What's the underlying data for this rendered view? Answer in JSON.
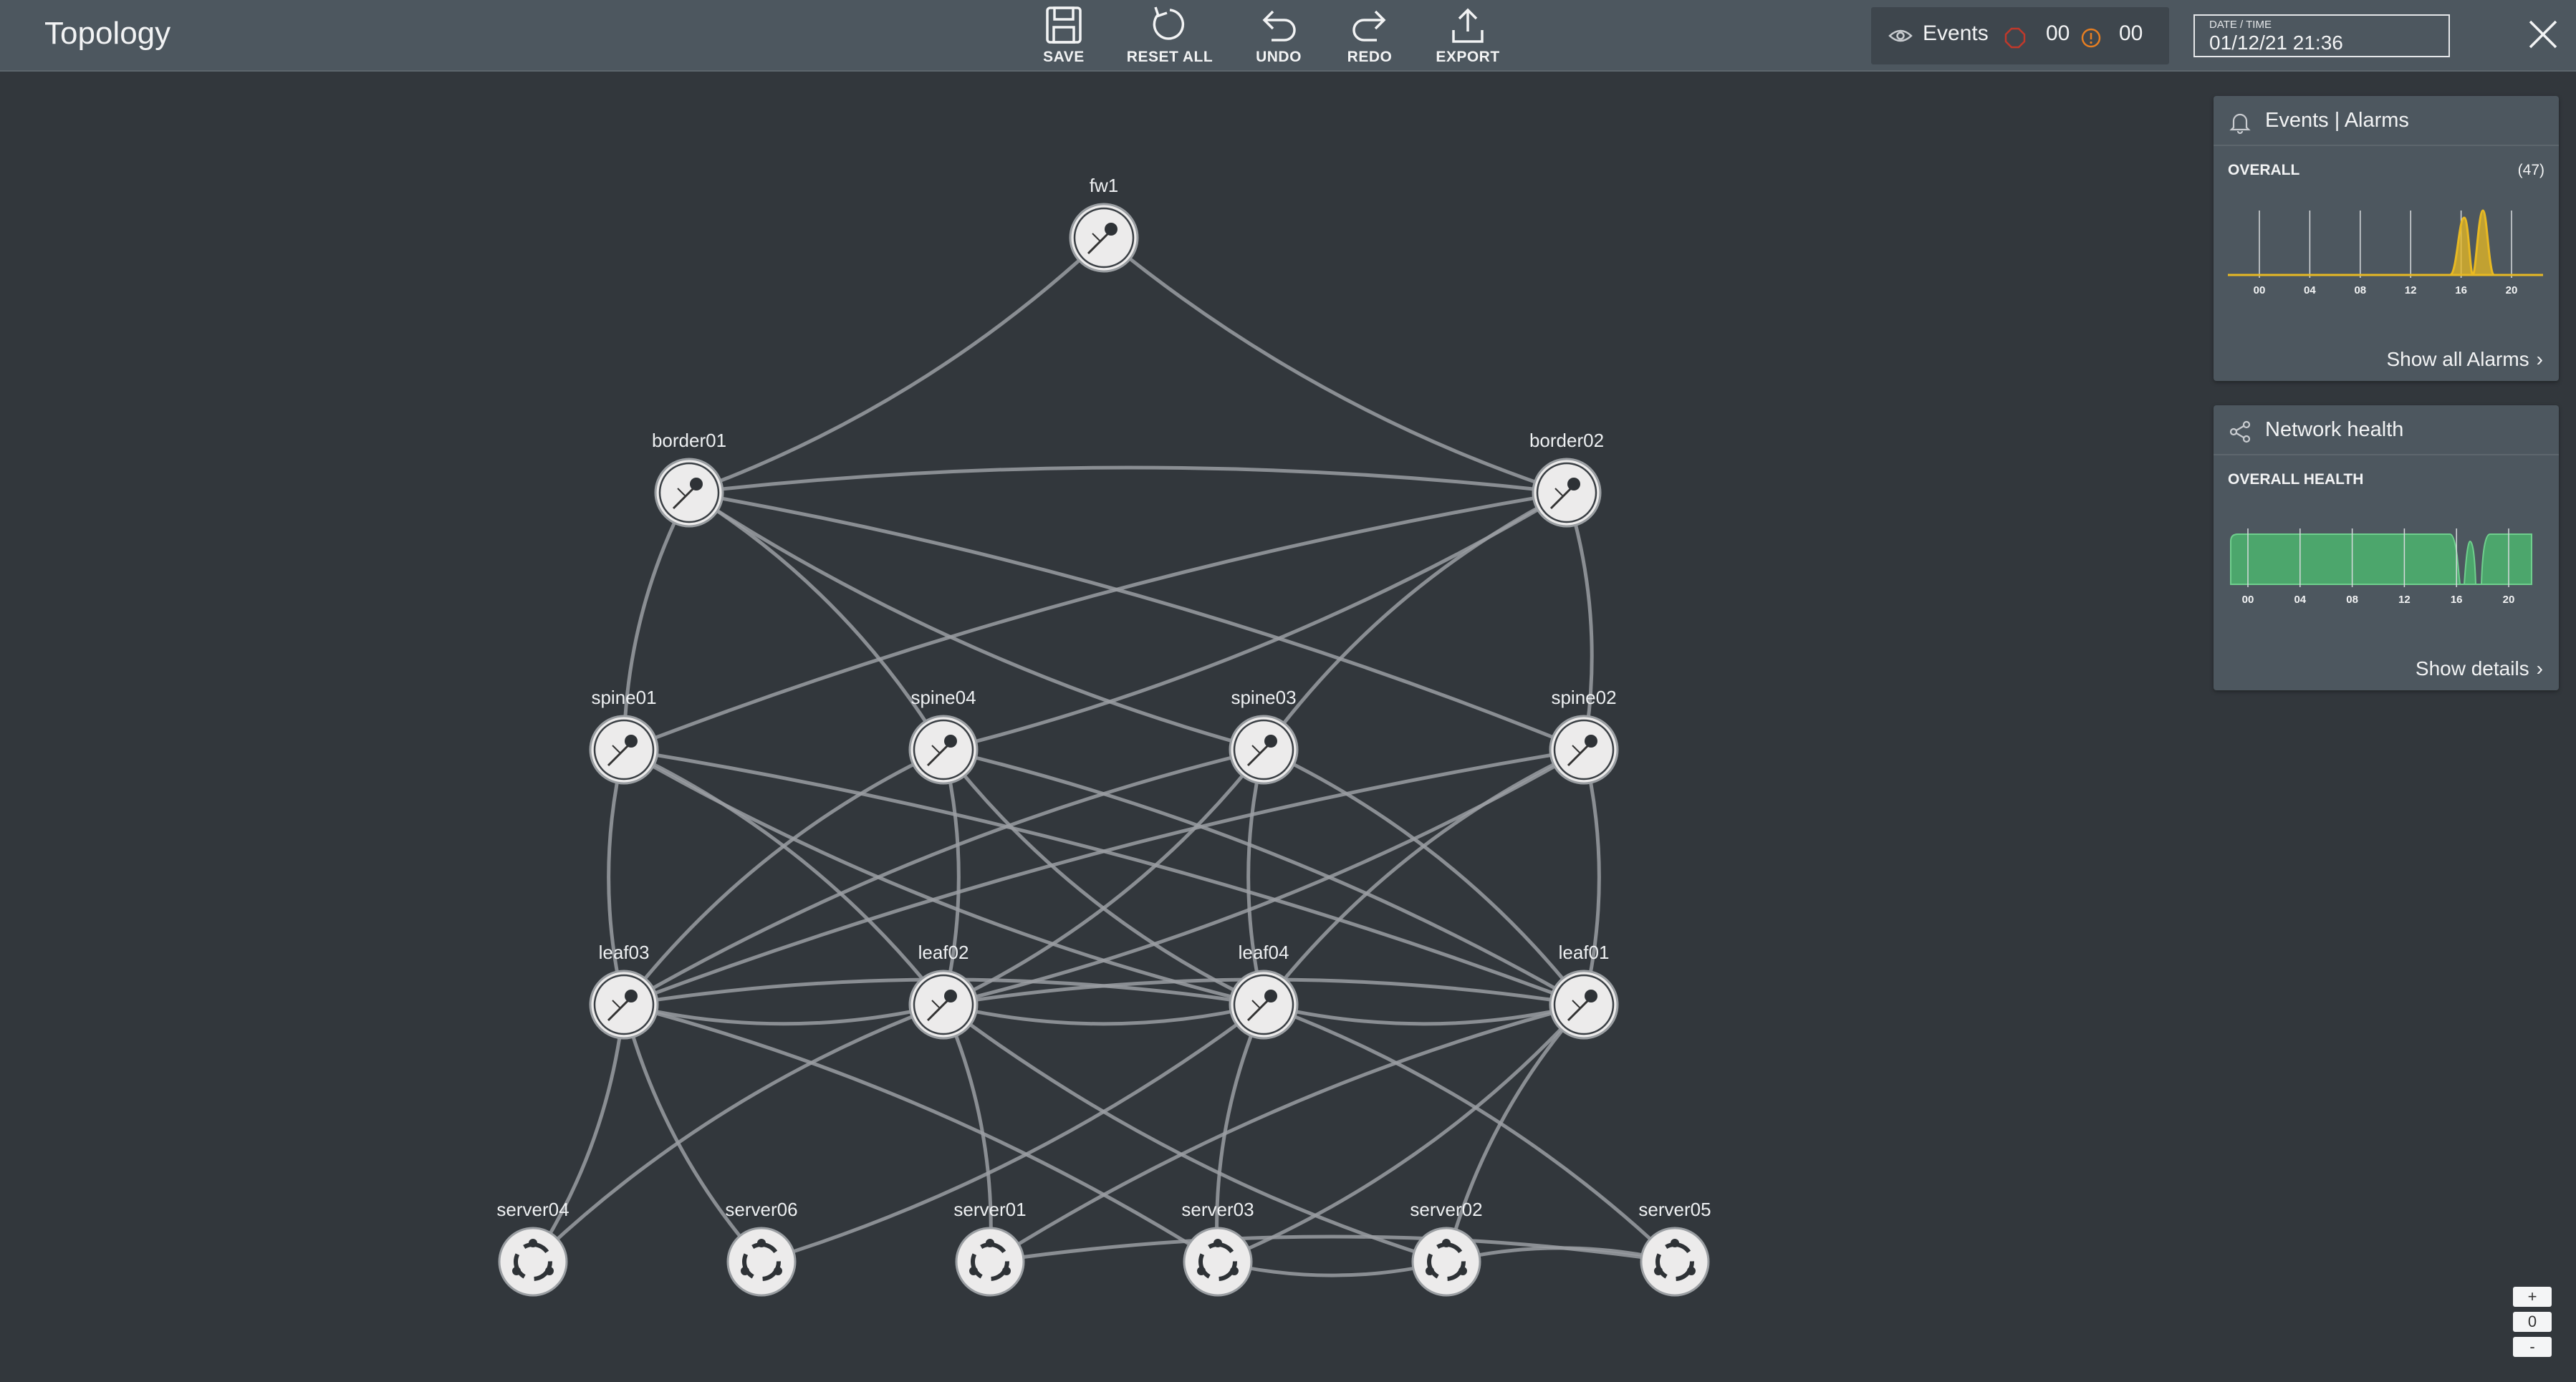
{
  "app": {
    "title": "Topology"
  },
  "toolbar": {
    "save": "SAVE",
    "reset_all": "RESET ALL",
    "undo": "UNDO",
    "redo": "REDO",
    "export": "EXPORT"
  },
  "events": {
    "label": "Events",
    "critical_count": "00",
    "warning_count": "00",
    "critical_color": "#c0392b",
    "warning_color": "#e67e22"
  },
  "datetime": {
    "label": "DATE / TIME",
    "value": "01/12/21 21:36"
  },
  "nodes": [
    {
      "id": "fw1",
      "label": "fw1",
      "type": "switch"
    },
    {
      "id": "border01",
      "label": "border01",
      "type": "switch"
    },
    {
      "id": "border02",
      "label": "border02",
      "type": "switch"
    },
    {
      "id": "spine01",
      "label": "spine01",
      "type": "switch"
    },
    {
      "id": "spine04",
      "label": "spine04",
      "type": "switch"
    },
    {
      "id": "spine03",
      "label": "spine03",
      "type": "switch"
    },
    {
      "id": "spine02",
      "label": "spine02",
      "type": "switch"
    },
    {
      "id": "leaf03",
      "label": "leaf03",
      "type": "switch"
    },
    {
      "id": "leaf02",
      "label": "leaf02",
      "type": "switch"
    },
    {
      "id": "leaf04",
      "label": "leaf04",
      "type": "switch"
    },
    {
      "id": "leaf01",
      "label": "leaf01",
      "type": "switch"
    },
    {
      "id": "server04",
      "label": "server04",
      "type": "server"
    },
    {
      "id": "server06",
      "label": "server06",
      "type": "server"
    },
    {
      "id": "server01",
      "label": "server01",
      "type": "server"
    },
    {
      "id": "server03",
      "label": "server03",
      "type": "server"
    },
    {
      "id": "server02",
      "label": "server02",
      "type": "server"
    },
    {
      "id": "server05",
      "label": "server05",
      "type": "server"
    }
  ],
  "links": [
    [
      "fw1",
      "border01"
    ],
    [
      "fw1",
      "border02"
    ],
    [
      "border01",
      "border02"
    ],
    [
      "border01",
      "spine01"
    ],
    [
      "border01",
      "spine04"
    ],
    [
      "border01",
      "spine03"
    ],
    [
      "border01",
      "spine02"
    ],
    [
      "border02",
      "spine01"
    ],
    [
      "border02",
      "spine04"
    ],
    [
      "border02",
      "spine03"
    ],
    [
      "border02",
      "spine02"
    ],
    [
      "spine01",
      "leaf03"
    ],
    [
      "spine01",
      "leaf02"
    ],
    [
      "spine01",
      "leaf04"
    ],
    [
      "spine01",
      "leaf01"
    ],
    [
      "spine04",
      "leaf03"
    ],
    [
      "spine04",
      "leaf02"
    ],
    [
      "spine04",
      "leaf04"
    ],
    [
      "spine04",
      "leaf01"
    ],
    [
      "spine03",
      "leaf03"
    ],
    [
      "spine03",
      "leaf02"
    ],
    [
      "spine03",
      "leaf04"
    ],
    [
      "spine03",
      "leaf01"
    ],
    [
      "spine02",
      "leaf03"
    ],
    [
      "spine02",
      "leaf02"
    ],
    [
      "spine02",
      "leaf04"
    ],
    [
      "spine02",
      "leaf01"
    ],
    [
      "leaf03",
      "leaf02"
    ],
    [
      "leaf03",
      "leaf04"
    ],
    [
      "leaf02",
      "leaf04"
    ],
    [
      "leaf02",
      "leaf01"
    ],
    [
      "leaf04",
      "leaf01"
    ],
    [
      "leaf03",
      "server04"
    ],
    [
      "leaf03",
      "server06"
    ],
    [
      "leaf03",
      "server03"
    ],
    [
      "leaf02",
      "server04"
    ],
    [
      "leaf02",
      "server01"
    ],
    [
      "leaf02",
      "server02"
    ],
    [
      "leaf04",
      "server06"
    ],
    [
      "leaf04",
      "server03"
    ],
    [
      "leaf04",
      "server05"
    ],
    [
      "leaf01",
      "server01"
    ],
    [
      "leaf01",
      "server03"
    ],
    [
      "leaf01",
      "server02"
    ],
    [
      "server01",
      "server05"
    ],
    [
      "server03",
      "server02"
    ],
    [
      "server02",
      "server05"
    ]
  ],
  "alarms_panel": {
    "title": "Events | Alarms",
    "subtitle": "OVERALL",
    "count": "(47)",
    "link": "Show all Alarms",
    "color": "#e8b923",
    "ticks": [
      "00",
      "04",
      "08",
      "12",
      "16",
      "20"
    ]
  },
  "health_panel": {
    "title": "Network health",
    "subtitle": "OVERALL HEALTH",
    "link": "Show details",
    "color": "#4caf6e",
    "ticks": [
      "00",
      "04",
      "08",
      "12",
      "16",
      "20"
    ]
  },
  "zoom": {
    "in": "+",
    "reset": "0",
    "out": "-"
  }
}
